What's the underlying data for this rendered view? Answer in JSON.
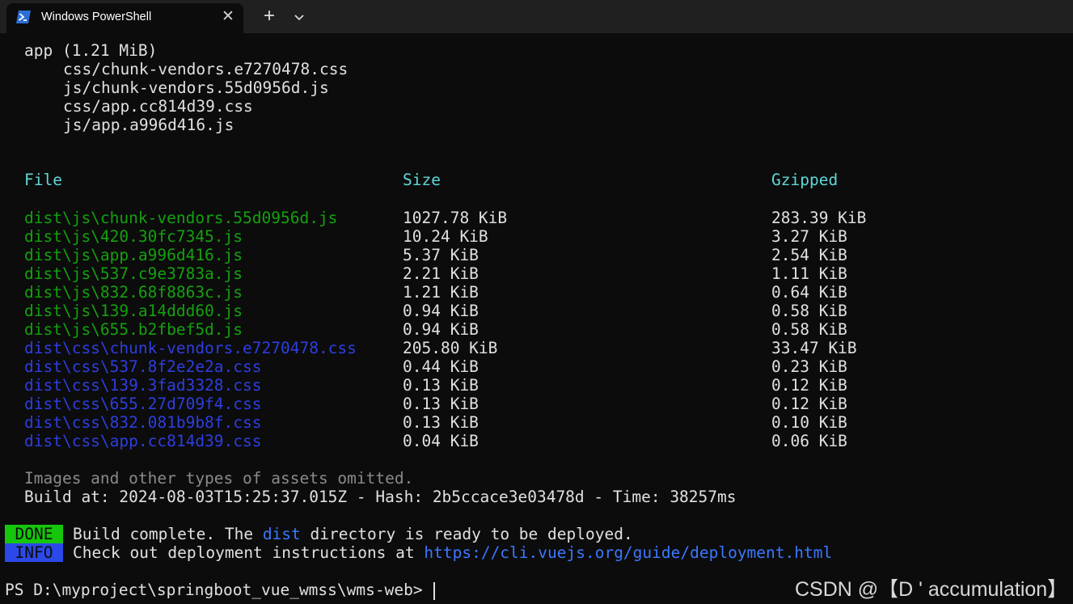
{
  "window": {
    "tab_title": "Windows PowerShell",
    "close_glyph": "✕",
    "new_tab_glyph": "+"
  },
  "output": {
    "app_header": "app (1.21 MiB)",
    "app_assets": [
      "css/chunk-vendors.e7270478.css",
      "js/chunk-vendors.55d0956d.js",
      "css/app.cc814d39.css",
      "js/app.a996d416.js"
    ],
    "table_headers": {
      "file": "File",
      "size": "Size",
      "gzipped": "Gzipped"
    },
    "files": [
      {
        "file": "dist\\js\\chunk-vendors.55d0956d.js",
        "size": "1027.78 KiB",
        "gzipped": "283.39 KiB",
        "kind": "js"
      },
      {
        "file": "dist\\js\\420.30fc7345.js",
        "size": "10.24 KiB",
        "gzipped": "3.27 KiB",
        "kind": "js"
      },
      {
        "file": "dist\\js\\app.a996d416.js",
        "size": "5.37 KiB",
        "gzipped": "2.54 KiB",
        "kind": "js"
      },
      {
        "file": "dist\\js\\537.c9e3783a.js",
        "size": "2.21 KiB",
        "gzipped": "1.11 KiB",
        "kind": "js"
      },
      {
        "file": "dist\\js\\832.68f8863c.js",
        "size": "1.21 KiB",
        "gzipped": "0.64 KiB",
        "kind": "js"
      },
      {
        "file": "dist\\js\\139.a14ddd60.js",
        "size": "0.94 KiB",
        "gzipped": "0.58 KiB",
        "kind": "js"
      },
      {
        "file": "dist\\js\\655.b2fbef5d.js",
        "size": "0.94 KiB",
        "gzipped": "0.58 KiB",
        "kind": "js"
      },
      {
        "file": "dist\\css\\chunk-vendors.e7270478.css",
        "size": "205.80 KiB",
        "gzipped": "33.47 KiB",
        "kind": "css"
      },
      {
        "file": "dist\\css\\537.8f2e2e2a.css",
        "size": "0.44 KiB",
        "gzipped": "0.23 KiB",
        "kind": "css"
      },
      {
        "file": "dist\\css\\139.3fad3328.css",
        "size": "0.13 KiB",
        "gzipped": "0.12 KiB",
        "kind": "css"
      },
      {
        "file": "dist\\css\\655.27d709f4.css",
        "size": "0.13 KiB",
        "gzipped": "0.12 KiB",
        "kind": "css"
      },
      {
        "file": "dist\\css\\832.081b9b8f.css",
        "size": "0.13 KiB",
        "gzipped": "0.10 KiB",
        "kind": "css"
      },
      {
        "file": "dist\\css\\app.cc814d39.css",
        "size": "0.04 KiB",
        "gzipped": "0.06 KiB",
        "kind": "css"
      }
    ],
    "omitted_note": "Images and other types of assets omitted.",
    "build_info": "Build at: 2024-08-03T15:25:37.015Z - Hash: 2b5ccace3e03478d - Time: 38257ms",
    "done": {
      "badge": " DONE ",
      "text_before": "Build complete. The ",
      "highlight": "dist",
      "text_after": " directory is ready to be deployed."
    },
    "info": {
      "badge": " INFO ",
      "text": "Check out deployment instructions at ",
      "link": "https://cli.vuejs.org/guide/deployment.html"
    },
    "prompt": "PS D:\\myproject\\springboot_vue_wmss\\wms-web> "
  },
  "watermark": "CSDN @【D ' accumulation】",
  "colors": {
    "background": "#0c0c0c",
    "js_file": "#13a10e",
    "css_file": "#2e3ee0",
    "header": "#61d6d6",
    "done_badge": "#16c60c",
    "info_badge": "#2b49e8",
    "link": "#3b78ff"
  }
}
